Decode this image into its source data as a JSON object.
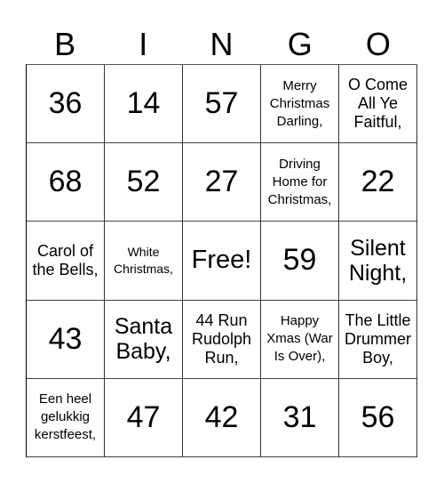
{
  "header": [
    "B",
    "I",
    "N",
    "G",
    "O"
  ],
  "cells": [
    {
      "text": "36",
      "size": "num"
    },
    {
      "text": "14",
      "size": "num"
    },
    {
      "text": "57",
      "size": "num"
    },
    {
      "text": "Merry Christmas Darling,",
      "size": "xs"
    },
    {
      "text": "O Come All Ye Faitful,",
      "size": "s"
    },
    {
      "text": "68",
      "size": "num"
    },
    {
      "text": "52",
      "size": "num"
    },
    {
      "text": "27",
      "size": "num"
    },
    {
      "text": "Driving Home for Christmas,",
      "size": "xs"
    },
    {
      "text": "22",
      "size": "num"
    },
    {
      "text": "Carol of the Bells,",
      "size": "s"
    },
    {
      "text": "White Christmas,",
      "size": "xxs"
    },
    {
      "text": "Free!",
      "size": "free"
    },
    {
      "text": "59",
      "size": "num"
    },
    {
      "text": "Silent Night,",
      "size": "l"
    },
    {
      "text": "43",
      "size": "num"
    },
    {
      "text": "Santa Baby,",
      "size": "l"
    },
    {
      "text": "44 Run Rudolph Run,",
      "size": "s"
    },
    {
      "text": "Happy Xmas (War Is Over),",
      "size": "xs"
    },
    {
      "text": "The Little Drummer Boy,",
      "size": "s"
    },
    {
      "text": "Een heel gelukkig kerstfeest,",
      "size": "xs"
    },
    {
      "text": "47",
      "size": "num"
    },
    {
      "text": "42",
      "size": "num"
    },
    {
      "text": "31",
      "size": "num"
    },
    {
      "text": "56",
      "size": "num"
    }
  ]
}
